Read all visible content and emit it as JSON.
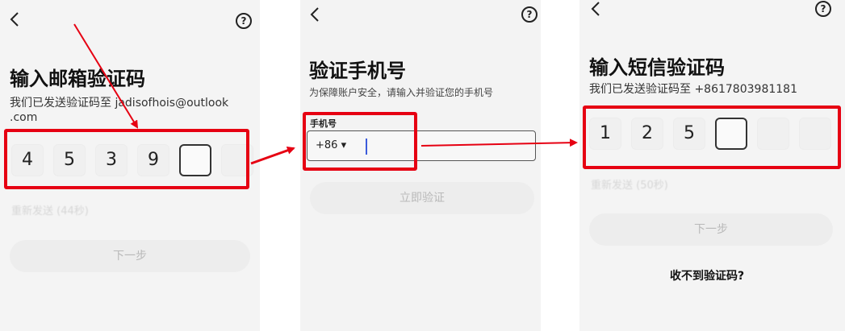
{
  "screen1": {
    "title": "输入邮箱验证码",
    "subtitle_line1": "我们已发送验证码至 jadisofhois@outlook",
    "subtitle_line2": ".com",
    "digits": [
      "4",
      "5",
      "3",
      "9"
    ],
    "resend": "重新发送 (44秒)",
    "next_button": "下一步"
  },
  "screen2": {
    "title": "验证手机号",
    "subtitle": "为保障账户安全，请输入并验证您的手机号",
    "phone_label": "手机号",
    "country_code": "+86 ▾",
    "verify_button": "立即验证"
  },
  "screen3": {
    "title": "输入短信验证码",
    "subtitle": "我们已发送验证码至 +8617803981181",
    "digits": [
      "1",
      "2",
      "5"
    ],
    "resend": "重新发送 (50秒)",
    "next_button": "下一步",
    "no_code_link": "收不到验证码?"
  },
  "colors": {
    "highlight": "#e60012",
    "panel_bg": "#f4f4f4",
    "caret": "#3b5bdb"
  },
  "icons": {
    "back": "chevron-left-icon",
    "help": "question-circle-icon"
  }
}
